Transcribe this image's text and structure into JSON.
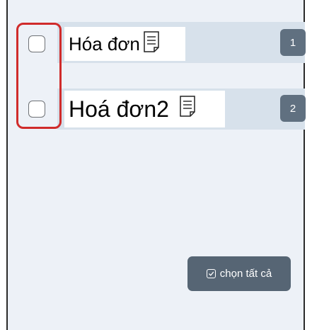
{
  "rows": [
    {
      "title": "Hóa đơn",
      "icon": "document-icon",
      "badge": "1"
    },
    {
      "title": "Hoá đơn2",
      "icon": "document-icon",
      "badge": "2"
    }
  ],
  "select_all": {
    "label": "chọn tất cả",
    "icon": "check-square-icon"
  },
  "colors": {
    "background": "#edf1f7",
    "row": "#d7e1eb",
    "badge": "#607080",
    "button": "#566574",
    "highlight": "#d02b2b"
  }
}
